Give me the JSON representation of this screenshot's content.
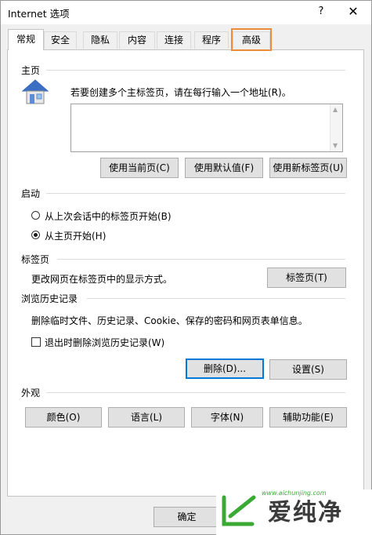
{
  "window": {
    "title": "Internet 选项",
    "help_label": "?",
    "close_label": "✕"
  },
  "tabs": [
    {
      "label": "常规",
      "active": true
    },
    {
      "label": "安全"
    },
    {
      "label": "隐私"
    },
    {
      "label": "内容"
    },
    {
      "label": "连接"
    },
    {
      "label": "程序"
    },
    {
      "label": "高级",
      "highlighted": true
    }
  ],
  "homepage": {
    "section_title": "主页",
    "description": "若要创建多个主标签页，请在每行输入一个地址(R)。",
    "url_value": "",
    "buttons": {
      "use_current": "使用当前页(C)",
      "use_default": "使用默认值(F)",
      "use_new_tab": "使用新标签页(U)"
    }
  },
  "startup": {
    "section_title": "启动",
    "option_last_session": "从上次会话中的标签页开始(B)",
    "option_homepage": "从主页开始(H)",
    "selected": "homepage"
  },
  "tabs_section": {
    "section_title": "标签页",
    "description": "更改网页在标签页中的显示方式。",
    "button": "标签页(T)"
  },
  "history": {
    "section_title": "浏览历史记录",
    "description": "删除临时文件、历史记录、Cookie、保存的密码和网页表单信息。",
    "checkbox_label": "退出时删除浏览历史记录(W)",
    "checkbox_checked": false,
    "delete_button": "删除(D)...",
    "settings_button": "设置(S)"
  },
  "appearance": {
    "section_title": "外观",
    "colors_button": "颜色(O)",
    "languages_button": "语言(L)",
    "fonts_button": "字体(N)",
    "accessibility_button": "辅助功能(E)"
  },
  "footer": {
    "ok_button": "确定"
  },
  "watermark": {
    "brand": "爱纯净",
    "url": "www.aichunjing.com"
  },
  "colors": {
    "highlight": "#ec8b3a",
    "focus": "#0078d7",
    "watermark_green": "#3aaa35"
  }
}
